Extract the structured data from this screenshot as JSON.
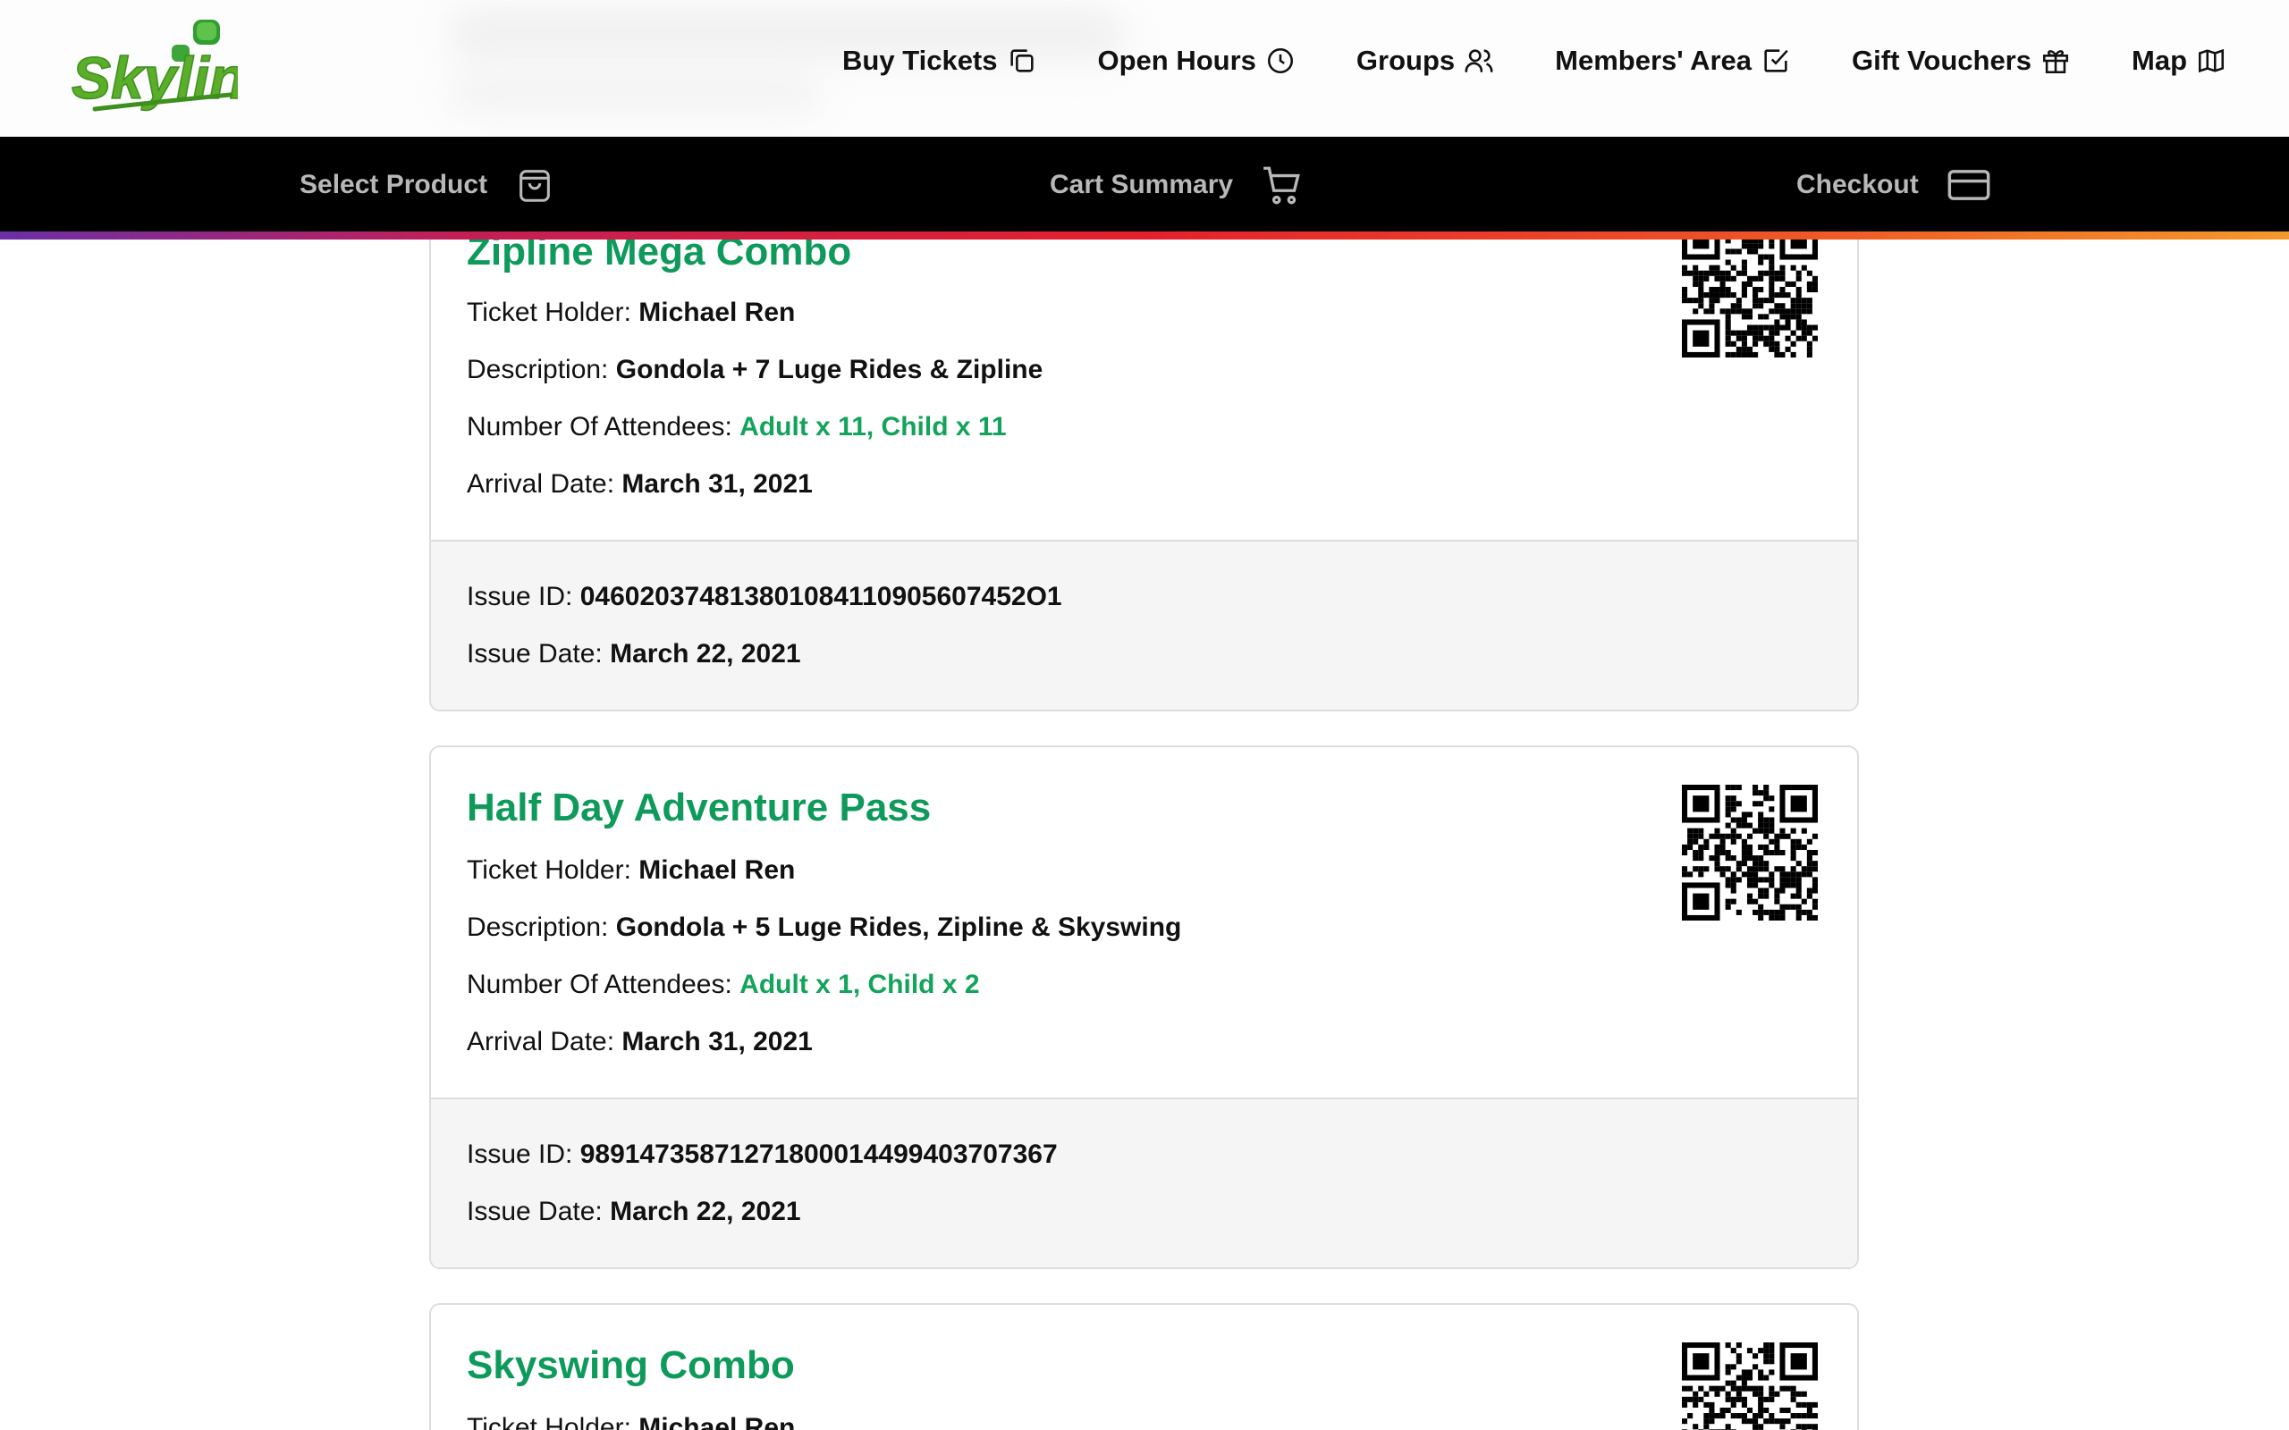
{
  "header": {
    "logo_text": "Skyline",
    "nav": [
      {
        "label": "Buy Tickets",
        "icon": "copy-icon"
      },
      {
        "label": "Open Hours",
        "icon": "clock-icon"
      },
      {
        "label": "Groups",
        "icon": "users-icon"
      },
      {
        "label": "Members' Area",
        "icon": "checkbox-icon"
      },
      {
        "label": "Gift Vouchers",
        "icon": "gift-icon"
      },
      {
        "label": "Map",
        "icon": "map-icon"
      }
    ]
  },
  "steps": [
    {
      "label": "Select Product",
      "icon": "shopping-bag-icon"
    },
    {
      "label": "Cart Summary",
      "icon": "cart-icon"
    },
    {
      "label": "Checkout",
      "icon": "credit-card-icon"
    }
  ],
  "colors": {
    "accent_green": "#0e9a5b",
    "attendee_green": "#13a35a",
    "step_bar": "#000000"
  },
  "labels": {
    "holder": "Ticket Holder:",
    "description": "Description:",
    "attendees": "Number Of Attendees:",
    "arrival": "Arrival Date:",
    "issue_id": "Issue ID:",
    "issue_date": "Issue Date:"
  },
  "tickets": [
    {
      "title": "Zipline Mega Combo",
      "holder": "Michael Ren",
      "description": "Gondola + 7 Luge Rides & Zipline",
      "attendees": "Adult x 11, Child x 11",
      "arrival": "March 31, 2021",
      "issue_id": "046020374813801084110905607452O1",
      "issue_date": "March 22, 2021"
    },
    {
      "title": "Half Day Adventure Pass",
      "holder": "Michael Ren",
      "description": "Gondola + 5 Luge Rides, Zipline & Skyswing",
      "attendees": "Adult x 1, Child x 2",
      "arrival": "March 31, 2021",
      "issue_id": "98914735871271800014499403707367",
      "issue_date": "March 22, 2021"
    },
    {
      "title": "Skyswing Combo",
      "holder": "Michael Ren"
    }
  ]
}
